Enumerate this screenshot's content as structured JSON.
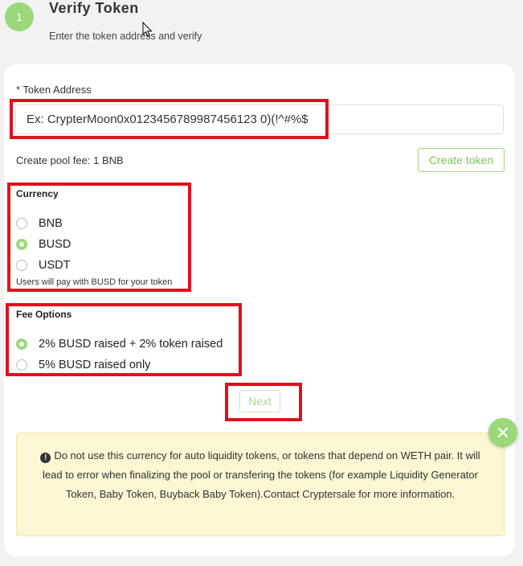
{
  "step": {
    "number": "1",
    "title": "Verify Token",
    "subtitle": "Enter the token address and verify"
  },
  "token_address": {
    "label": "* Token Address",
    "placeholder": "Ex: CrypterMoon0x0123456789987456123 0)(!^#%$"
  },
  "pool_fee": {
    "text": "Create pool fee: 1 BNB",
    "create_button": "Create token"
  },
  "currency": {
    "title": "Currency",
    "options": [
      "BNB",
      "BUSD",
      "USDT"
    ],
    "selected": "BUSD",
    "hint": "Users will pay with BUSD for your token"
  },
  "fee_options": {
    "title": "Fee Options",
    "options": [
      "2% BUSD raised + 2% token raised",
      "5% BUSD raised only"
    ],
    "selected": "2% BUSD raised + 2% token raised"
  },
  "next_button": "Next",
  "warning": {
    "icon": "exclamation-circle-icon",
    "text": "Do not use this currency for auto liquidity tokens, or tokens that depend on WETH pair. It will lead to error when finalizing the pool or transfering the tokens (for example Liquidity Generator Token, Baby Token, Buyback Baby Token).Contact Cryptersale for more information."
  },
  "colors": {
    "accent": "#9bd87a",
    "highlight": "#e0101c",
    "warning_bg": "#fbf6d4"
  }
}
